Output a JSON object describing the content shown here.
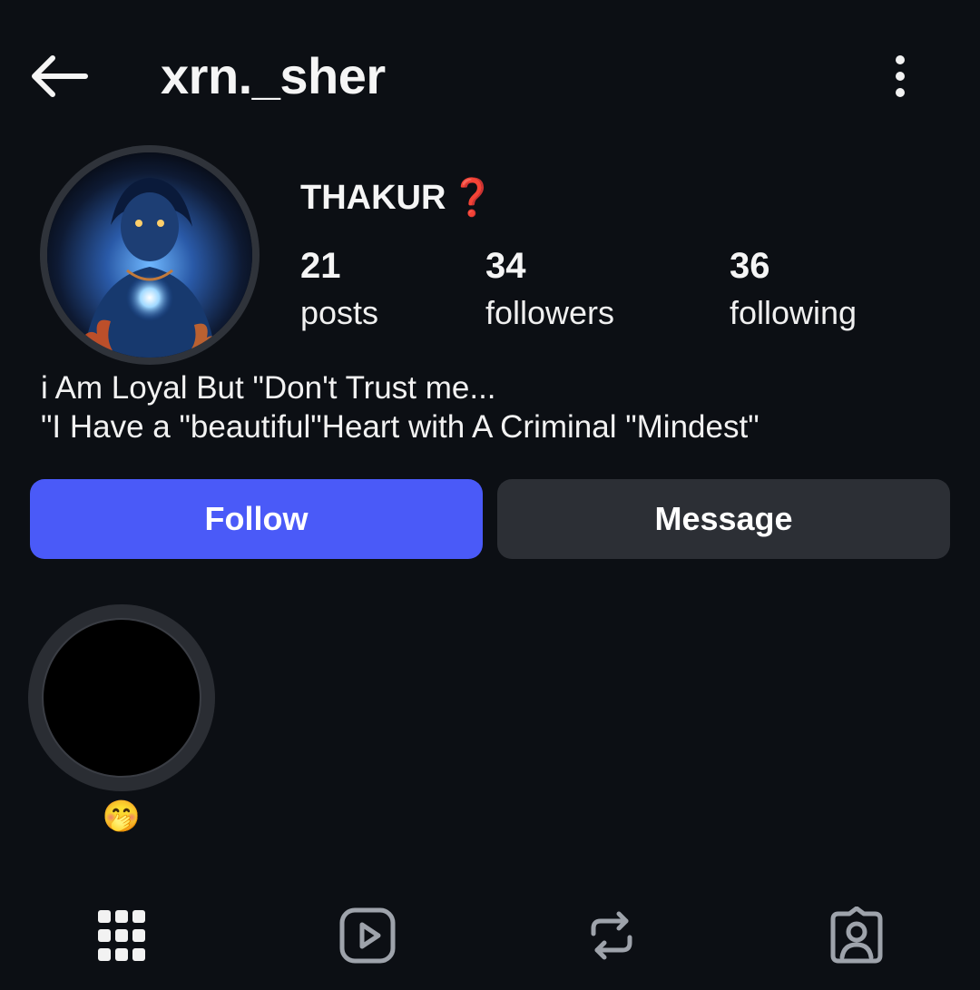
{
  "header": {
    "username": "xrn._sher",
    "back_icon": "arrow-left-icon",
    "more_icon": "more-vertical-icon"
  },
  "profile": {
    "display_name": "THAKUR",
    "display_name_emoji": "❓",
    "stats": [
      {
        "value": "21",
        "label": "posts"
      },
      {
        "value": "34",
        "label": "followers"
      },
      {
        "value": "36",
        "label": "following"
      }
    ],
    "bio_lines": [
      "i Am Loyal But \"Don't Trust me...",
      "\"I Have a \"beautiful\"Heart with A Criminal \"Mindest\""
    ]
  },
  "actions": {
    "follow_label": "Follow",
    "message_label": "Message"
  },
  "highlights": [
    {
      "label": "🤭"
    }
  ],
  "tabs": [
    {
      "name": "grid",
      "icon": "grid-icon"
    },
    {
      "name": "reels",
      "icon": "reels-play-icon"
    },
    {
      "name": "reposts",
      "icon": "repost-icon"
    },
    {
      "name": "tagged",
      "icon": "tagged-person-icon"
    }
  ],
  "colors": {
    "background": "#0c0f14",
    "follow_button": "#4a5af8",
    "message_button": "#2c2f35",
    "question_mark": "#e02a2a"
  }
}
